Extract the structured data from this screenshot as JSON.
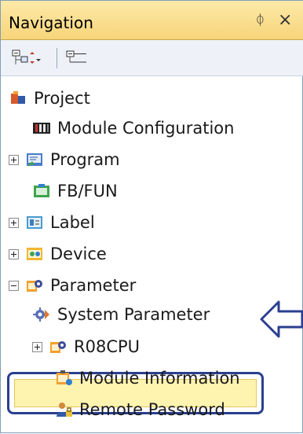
{
  "panel": {
    "title": "Navigation",
    "pin_glyph": "ᛰ",
    "close_glyph": "×"
  },
  "toolbar": {
    "buttons": [
      {
        "icon": "collapse-expand-dropdown-icon"
      },
      {
        "icon": "tree-view-icon"
      }
    ]
  },
  "tree": {
    "items": [
      {
        "label": "Project",
        "icon": "project-icon",
        "expander": "none"
      },
      {
        "label": "Module Configuration",
        "icon": "module-configuration-icon",
        "expander": "none"
      },
      {
        "label": "Program",
        "icon": "program-icon",
        "expander": "plus"
      },
      {
        "label": "FB/FUN",
        "icon": "fb-fun-icon",
        "expander": "none"
      },
      {
        "label": "Label",
        "icon": "label-icon",
        "expander": "plus"
      },
      {
        "label": "Device",
        "icon": "device-icon",
        "expander": "plus"
      },
      {
        "label": "Parameter",
        "icon": "parameter-icon",
        "expander": "minus"
      },
      {
        "label": "System Parameter",
        "icon": "system-parameter-icon",
        "expander": "none",
        "selected": true
      },
      {
        "label": "R08CPU",
        "icon": "cpu-parameter-icon",
        "expander": "plus"
      },
      {
        "label": "Module Information",
        "icon": "module-information-icon",
        "expander": "none"
      },
      {
        "label": "Remote Password",
        "icon": "remote-password-icon",
        "expander": "none"
      }
    ]
  },
  "colors": {
    "title_bar": "#f7d57a",
    "selection_border": "#2a3f8f",
    "selection_fill": "#fff3b0",
    "callout_arrow": "#2a3f8f"
  }
}
